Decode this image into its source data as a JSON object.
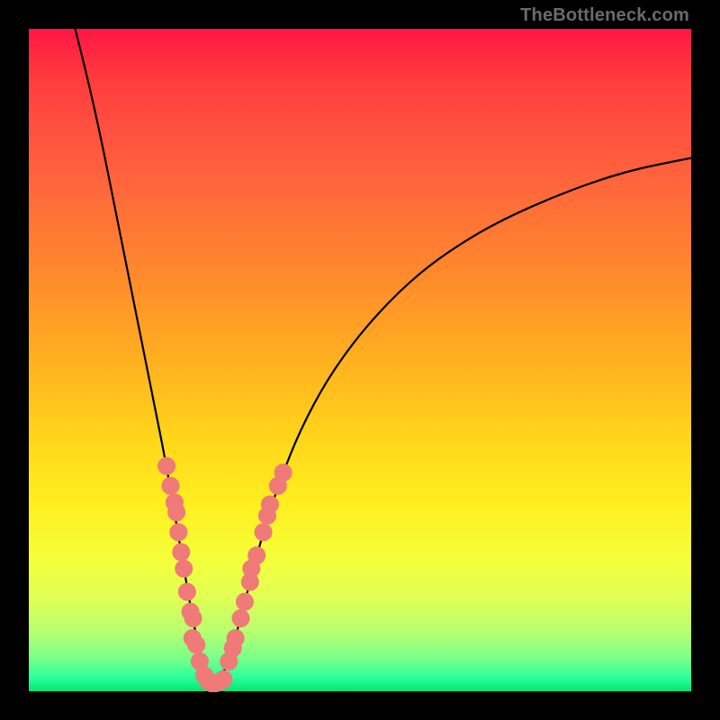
{
  "watermark": "TheBottleneck.com",
  "colors": {
    "frame": "#000000",
    "curve": "#000000",
    "dot": "#ef7a77",
    "gradient_top": "#ff1744",
    "gradient_bottom": "#00e676"
  },
  "chart_data": {
    "type": "line",
    "title": "",
    "xlabel": "",
    "ylabel": "",
    "xlim": [
      0,
      100
    ],
    "ylim": [
      0,
      100
    ],
    "grid": false,
    "curve": {
      "comment": "V-shaped bottleneck curve. x in percent of horizontal axis, y in percent of vertical axis (0 = bottom, 100 = top). Minimum around x≈27.",
      "points": [
        {
          "x": 7.0,
          "y": 100.0
        },
        {
          "x": 9.0,
          "y": 92.0
        },
        {
          "x": 11.0,
          "y": 83.0
        },
        {
          "x": 13.0,
          "y": 73.0
        },
        {
          "x": 15.0,
          "y": 63.0
        },
        {
          "x": 17.0,
          "y": 53.0
        },
        {
          "x": 19.0,
          "y": 43.0
        },
        {
          "x": 20.5,
          "y": 35.5
        },
        {
          "x": 22.0,
          "y": 27.0
        },
        {
          "x": 23.5,
          "y": 18.0
        },
        {
          "x": 25.0,
          "y": 9.5
        },
        {
          "x": 26.5,
          "y": 3.0
        },
        {
          "x": 27.5,
          "y": 1.2
        },
        {
          "x": 28.5,
          "y": 1.2
        },
        {
          "x": 30.0,
          "y": 4.0
        },
        {
          "x": 32.0,
          "y": 11.0
        },
        {
          "x": 34.0,
          "y": 19.0
        },
        {
          "x": 36.0,
          "y": 26.0
        },
        {
          "x": 38.0,
          "y": 32.0
        },
        {
          "x": 41.0,
          "y": 39.5
        },
        {
          "x": 45.0,
          "y": 47.0
        },
        {
          "x": 50.0,
          "y": 54.0
        },
        {
          "x": 56.0,
          "y": 60.5
        },
        {
          "x": 62.0,
          "y": 65.5
        },
        {
          "x": 70.0,
          "y": 70.5
        },
        {
          "x": 80.0,
          "y": 75.0
        },
        {
          "x": 90.0,
          "y": 78.5
        },
        {
          "x": 100.0,
          "y": 80.5
        }
      ]
    },
    "series": [
      {
        "name": "left-cluster",
        "comment": "Salmon data points along the descending left arm of the V.",
        "points": [
          {
            "x": 20.8,
            "y": 34.0
          },
          {
            "x": 21.4,
            "y": 31.0
          },
          {
            "x": 22.0,
            "y": 28.5
          },
          {
            "x": 22.3,
            "y": 27.0
          },
          {
            "x": 22.6,
            "y": 24.0
          },
          {
            "x": 23.0,
            "y": 21.0
          },
          {
            "x": 23.4,
            "y": 18.5
          },
          {
            "x": 23.9,
            "y": 15.0
          },
          {
            "x": 24.4,
            "y": 12.0
          },
          {
            "x": 24.8,
            "y": 11.0
          },
          {
            "x": 24.7,
            "y": 8.0
          },
          {
            "x": 25.3,
            "y": 7.0
          },
          {
            "x": 25.8,
            "y": 4.5
          },
          {
            "x": 26.5,
            "y": 2.4
          }
        ]
      },
      {
        "name": "bottom-cluster",
        "comment": "Salmon data points fanning across the V trough.",
        "points": [
          {
            "x": 27.0,
            "y": 1.6
          },
          {
            "x": 27.6,
            "y": 1.2
          },
          {
            "x": 28.2,
            "y": 1.2
          },
          {
            "x": 28.8,
            "y": 1.4
          },
          {
            "x": 29.4,
            "y": 1.8
          }
        ]
      },
      {
        "name": "right-cluster",
        "comment": "Salmon data points along the ascending right arm of the V.",
        "points": [
          {
            "x": 30.2,
            "y": 4.5
          },
          {
            "x": 30.8,
            "y": 6.5
          },
          {
            "x": 31.2,
            "y": 8.0
          },
          {
            "x": 32.0,
            "y": 11.0
          },
          {
            "x": 32.6,
            "y": 13.5
          },
          {
            "x": 33.4,
            "y": 16.5
          },
          {
            "x": 33.6,
            "y": 18.5
          },
          {
            "x": 34.4,
            "y": 20.5
          },
          {
            "x": 35.4,
            "y": 24.0
          },
          {
            "x": 36.0,
            "y": 26.5
          },
          {
            "x": 36.4,
            "y": 28.2
          },
          {
            "x": 37.6,
            "y": 31.0
          },
          {
            "x": 38.4,
            "y": 33.0
          }
        ]
      }
    ]
  }
}
